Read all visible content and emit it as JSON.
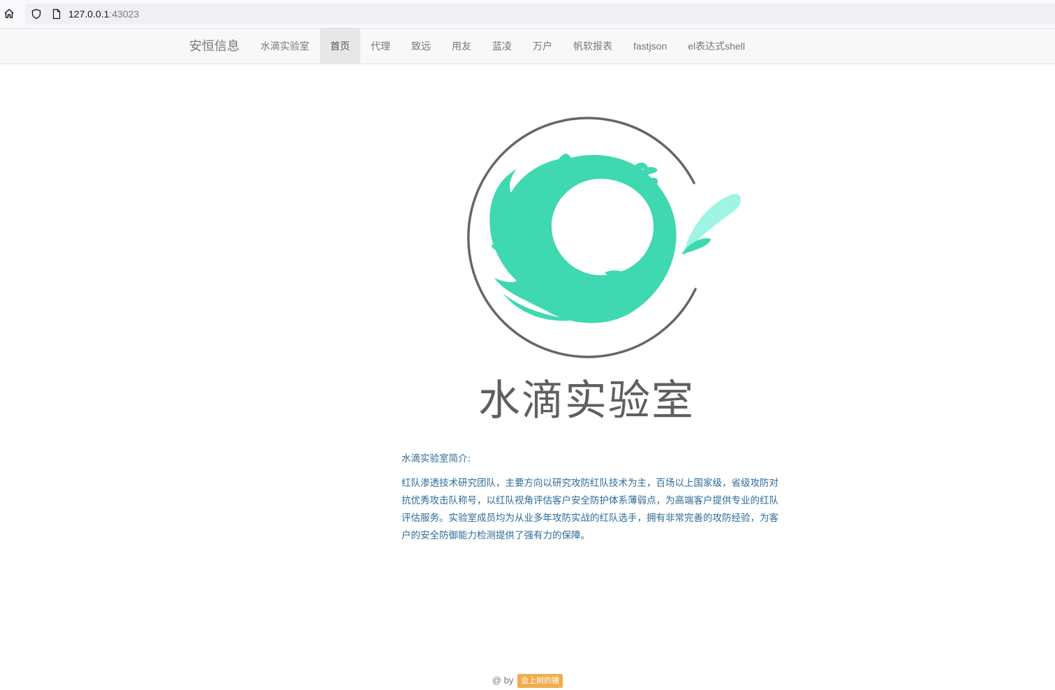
{
  "browser": {
    "url_host": "127.0.0.1",
    "url_port": ":43023",
    "icons": [
      "home-icon",
      "shield-icon",
      "page-icon"
    ]
  },
  "navbar": {
    "brand": "安恒信息",
    "items": [
      {
        "label": "水滴实验室",
        "active": false
      },
      {
        "label": "首页",
        "active": true
      },
      {
        "label": "代理",
        "active": false
      },
      {
        "label": "致远",
        "active": false
      },
      {
        "label": "用友",
        "active": false
      },
      {
        "label": "蓝凌",
        "active": false
      },
      {
        "label": "万户",
        "active": false
      },
      {
        "label": "帆软报表",
        "active": false
      },
      {
        "label": "fastjson",
        "active": false
      },
      {
        "label": "el表达式shell",
        "active": false
      }
    ]
  },
  "logo": {
    "title": "水滴实验室",
    "ring_color": "#666666",
    "splash_color": "#3fd8b0",
    "droplet_color": "#9ef5e3"
  },
  "intro": {
    "heading": "水滴实验室简介:",
    "body": "红队渗透技术研究团队，主要方向以研究攻防红队技术为主，百场以上国家级，省级攻防对抗优秀攻击队称号，以红队视角评估客户安全防护体系薄弱点，为高端客户提供专业的红队评估服务。实验室成员均为从业多年攻防实战的红队选手，拥有非常完善的攻防经验，为客户的安全防御能力检测提供了强有力的保障。",
    "text_color": "#2d6b9b"
  },
  "footer": {
    "prefix": "@ by",
    "author": "会上树的猪",
    "badge_color": "#f0ad4e"
  }
}
